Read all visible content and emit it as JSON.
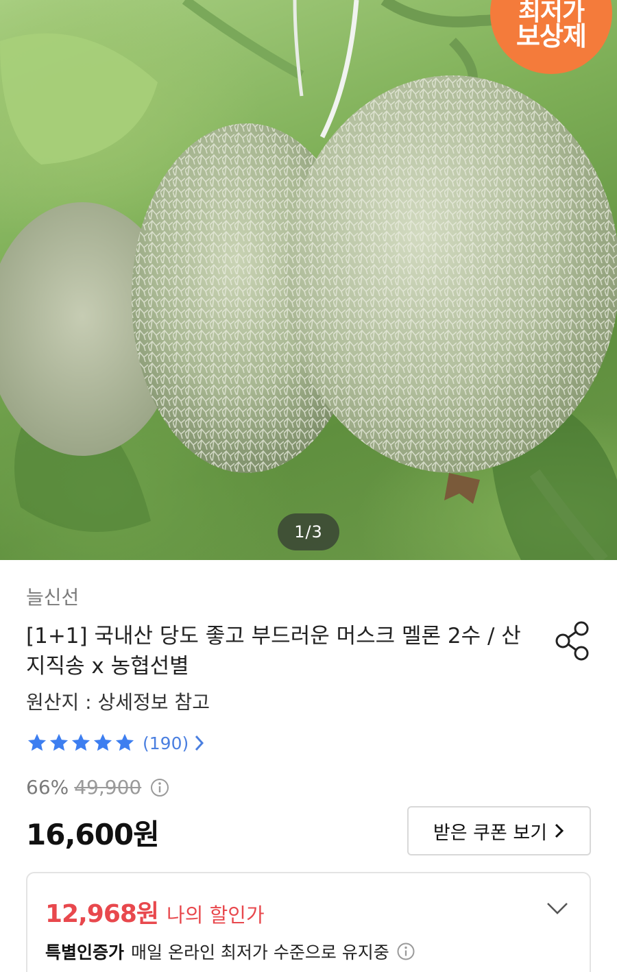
{
  "hero": {
    "badge_line1": "최저가",
    "badge_line2": "보상제",
    "page_indicator": "1/3",
    "badge_color": "#f47b3b"
  },
  "product": {
    "brand": "늘신선",
    "title": "[1+1] 국내산 당도 좋고 부드러운 머스크 멜론 2수 / 산지직송 x 농협선별",
    "origin": "원산지 : 상세정보 참고",
    "rating_stars": 5,
    "review_count": "(190)",
    "discount_rate": "66%",
    "original_price": "49,900",
    "price": "16,600원",
    "coupon_button": "받은 쿠폰 보기",
    "my_price_value": "12,968원",
    "my_price_label": "나의 할인가",
    "cert_title": "특별인증가",
    "cert_text": "매일 온라인 최저가 수준으로 유지중"
  },
  "colors": {
    "accent_red": "#e8484d",
    "star_blue": "#3d7ef0",
    "link_blue": "#4a7fe0"
  },
  "icons": [
    "share-icon",
    "star-icon",
    "chevron-right-icon",
    "info-icon",
    "chevron-down-icon"
  ]
}
